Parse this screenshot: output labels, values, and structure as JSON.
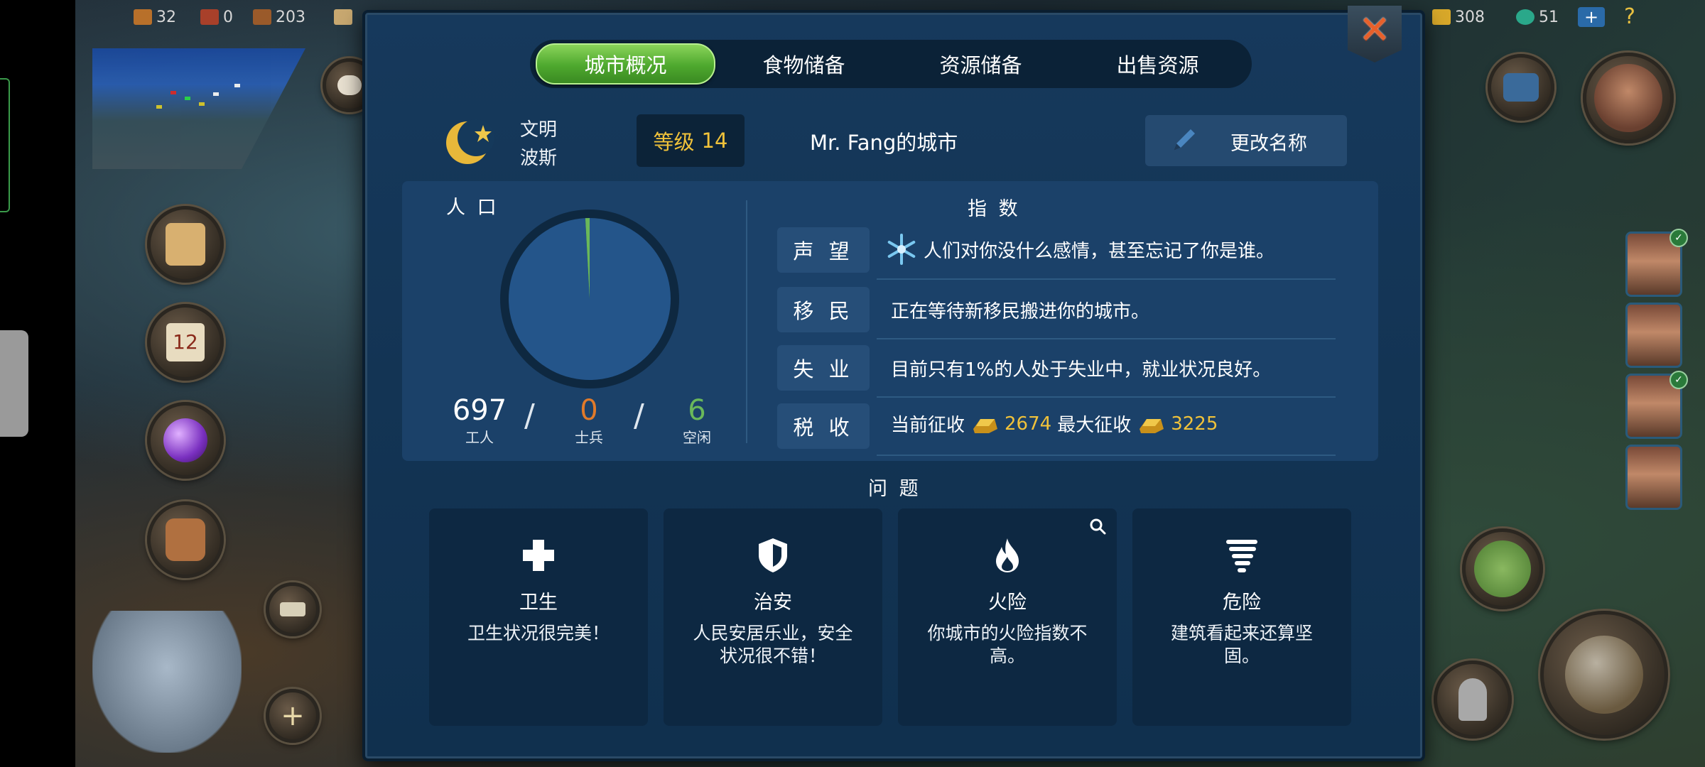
{
  "resources_left": [
    {
      "name": "wood",
      "value": "32",
      "color": "#b8702a"
    },
    {
      "name": "brick",
      "value": "0",
      "color": "#a8402a"
    },
    {
      "name": "lumber",
      "value": "203",
      "color": "#9a5a2a"
    }
  ],
  "resources_right": [
    {
      "name": "gold",
      "value": "308",
      "color": "#d8a82a"
    },
    {
      "name": "gem",
      "value": "51",
      "color": "#2aa88a"
    }
  ],
  "tabs": [
    {
      "label": "城市概况",
      "active": true
    },
    {
      "label": "食物储备",
      "active": false
    },
    {
      "label": "资源储备",
      "active": false
    },
    {
      "label": "出售资源",
      "active": false
    }
  ],
  "header": {
    "civ_label": "文明",
    "civ_name": "波斯",
    "level_label": "等级",
    "level_value": "14",
    "city_name": "Mr. Fang的城市",
    "rename_label": "更改名称"
  },
  "population": {
    "title": "人 口",
    "workers_value": "697",
    "workers_label": "工人",
    "soldiers_value": "0",
    "soldiers_label": "士兵",
    "idle_value": "6",
    "idle_label": "空闲",
    "colors": {
      "workers": "#24558a",
      "soldiers": "#e07a2a",
      "idle": "#6ab85a"
    }
  },
  "chart_data": {
    "type": "pie",
    "labels": [
      "工人",
      "士兵",
      "空闲"
    ],
    "values": [
      697,
      0,
      6
    ],
    "colors": [
      "#24558a",
      "#e07a2a",
      "#6ab85a"
    ]
  },
  "indices": {
    "title": "指 数",
    "rows": [
      {
        "key": "声 望",
        "text": "人们对你没什么感情，甚至忘记了你是谁。",
        "icon": "snowflake-icon"
      },
      {
        "key": "移 民",
        "text": "正在等待新移民搬进你的城市。"
      },
      {
        "key": "失 业",
        "text": "目前只有1%的人处于失业中，就业状况良好。"
      },
      {
        "key": "税 收",
        "current_label": "当前征收",
        "current_value": "2674",
        "max_label": "最大征收",
        "max_value": "3225"
      }
    ]
  },
  "problems": {
    "title": "问 题",
    "cards": [
      {
        "title": "卫生",
        "text": "卫生状况很完美！",
        "icon": "health-cross-icon"
      },
      {
        "title": "治安",
        "text": "人民安居乐业，安全状况很不错！",
        "icon": "shield-icon"
      },
      {
        "title": "火险",
        "text": "你城市的火险指数不高。",
        "icon": "flame-icon"
      },
      {
        "title": "危险",
        "text": "建筑看起来还算坚固。",
        "icon": "tornado-icon"
      }
    ]
  }
}
